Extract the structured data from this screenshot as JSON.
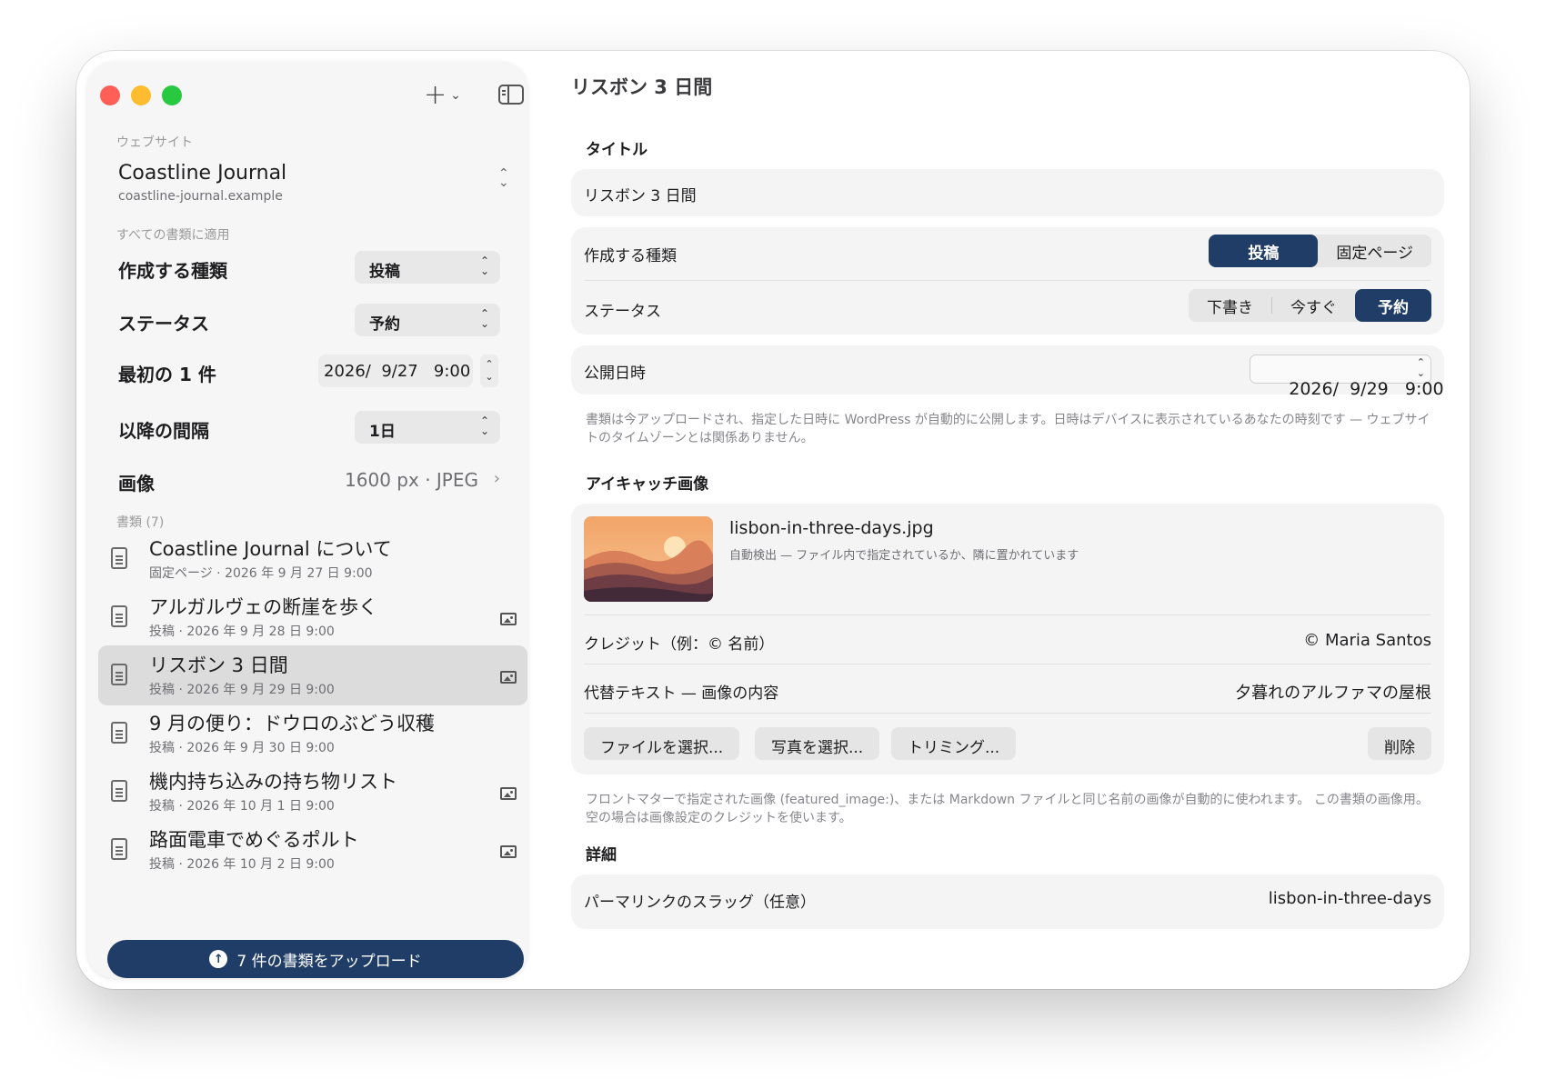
{
  "window": {
    "title": "リスボン 3 日間"
  },
  "sidebar": {
    "toolbar": {
      "add_symbol": "+",
      "add_chevron": "⌄"
    },
    "website_caption": "ウェブサイト",
    "site": {
      "name": "Coastline Journal",
      "url": "coastline-journal.example",
      "chevron": "⌃\n⌄"
    },
    "apply_caption": "すべての書類に適用",
    "settings": {
      "kind": {
        "label": "作成する種類",
        "value": "投稿"
      },
      "status": {
        "label": "ステータス",
        "value": "予約"
      },
      "first": {
        "label": "最初の 1 件",
        "value": "2026/  9/27   9:00"
      },
      "interval": {
        "label": "以降の間隔",
        "value": "1日"
      },
      "image": {
        "label": "画像",
        "value": "1600 px · JPEG"
      }
    },
    "docs_caption": "書類 (7)",
    "documents": [
      {
        "title": "Coastline Journal について",
        "meta": "固定ページ · 2026 年 9 月 27 日 9:00",
        "has_image": false
      },
      {
        "title": "アルガルヴェの断崖を歩く",
        "meta": "投稿 · 2026 年 9 月 28 日 9:00",
        "has_image": true
      },
      {
        "title": "リスボン 3 日間",
        "meta": "投稿 · 2026 年 9 月 29 日 9:00",
        "has_image": true,
        "selected": true
      },
      {
        "title": "9 月の便り：ドウロのぶどう収穫",
        "meta": "投稿 · 2026 年 9 月 30 日 9:00",
        "has_image": false
      },
      {
        "title": "機内持ち込みの持ち物リスト",
        "meta": "投稿 · 2026 年 10 月 1 日 9:00",
        "has_image": true
      },
      {
        "title": "路面電車でめぐるポルト",
        "meta": "投稿 · 2026 年 10 月 2 日 9:00",
        "has_image": true
      }
    ],
    "upload_label": "7 件の書類をアップロード"
  },
  "main": {
    "title_heading": "タイトル",
    "title_value": "リスボン 3 日間",
    "kind_label": "作成する種類",
    "kind_options": [
      "投稿",
      "固定ページ"
    ],
    "status_label": "ステータス",
    "status_options": [
      "下書き",
      "今すぐ",
      "予約"
    ],
    "publish_label": "公開日時",
    "publish_value": "2026/  9/29   9:00",
    "publish_note": "書類は今アップロードされ、指定した日時に WordPress が自動的に公開します。日時はデバイスに表示されているあなたの時刻です — ウェブサイトのタイムゾーンとは関係ありません。",
    "featured_heading": "アイキャッチ画像",
    "featured_file": "lisbon-in-three-days.jpg",
    "featured_file_note": "自動検出 — ファイル内で指定されているか、隣に置かれています",
    "credit_label": "クレジット（例：© 名前）",
    "credit_value": "© Maria Santos",
    "alt_label": "代替テキスト — 画像の内容",
    "alt_value": "夕暮れのアルファマの屋根",
    "buttons": {
      "choose_file": "ファイルを選択...",
      "choose_photo": "写真を選択...",
      "trim": "トリミング...",
      "delete": "削除"
    },
    "featured_note": "フロントマターで指定された画像 (featured_image:)、または Markdown ファイルと同じ名前の画像が自動的に使われます。 この書類の画像用。空の場合は画像設定のクレジットを使います。",
    "details_heading": "詳細",
    "slug_label": "パーマリンクのスラッグ（任意）",
    "slug_value": "lisbon-in-three-days"
  },
  "colors": {
    "accent": "#1f3d66",
    "sidebar_bg": "#f7f6f6",
    "card_bg": "#f5f4f4"
  }
}
